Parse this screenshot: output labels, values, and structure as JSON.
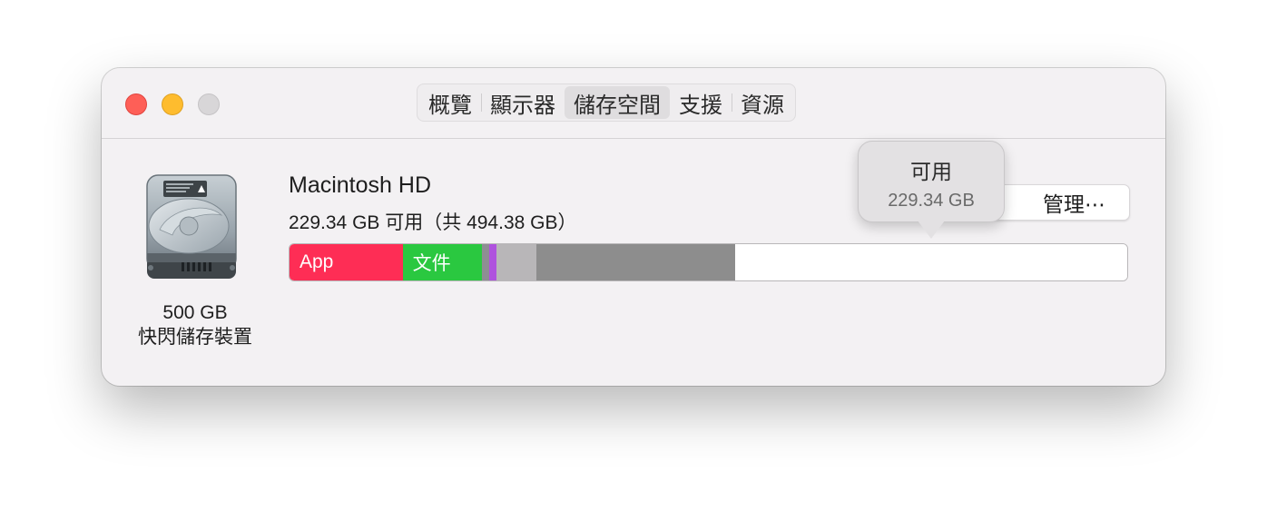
{
  "window": {
    "traffic_lights": [
      "close",
      "minimize",
      "zoom"
    ]
  },
  "tabs": [
    {
      "label": "概覽",
      "active": false
    },
    {
      "label": "顯示器",
      "active": false
    },
    {
      "label": "儲存空間",
      "active": true
    },
    {
      "label": "支援",
      "active": false
    },
    {
      "label": "資源",
      "active": false
    }
  ],
  "disk": {
    "icon": "hard-drive-icon",
    "capacity": "500 GB",
    "type": "快閃儲存裝置",
    "name": "Macintosh HD",
    "usage_text": "229.34 GB 可用（共 494.38 GB）"
  },
  "storage_bar": {
    "segments": [
      {
        "label": "App",
        "color": "#fe2d55",
        "share": 0.135
      },
      {
        "label": "文件",
        "color": "#2ac840",
        "share": 0.095
      },
      {
        "label": "",
        "color": "#8e8e93",
        "share": 0.008
      },
      {
        "label": "",
        "color": "#af52de",
        "share": 0.009
      },
      {
        "label": "",
        "color": "#b8b6b8",
        "share": 0.048
      },
      {
        "label": "",
        "color": "#8d8d8d",
        "share": 0.237
      },
      {
        "label": "",
        "color": "#ffffff",
        "share": 0.468
      }
    ]
  },
  "manage_button": {
    "label": "管理⋯"
  },
  "tooltip": {
    "title": "可用",
    "value": "229.34 GB"
  }
}
